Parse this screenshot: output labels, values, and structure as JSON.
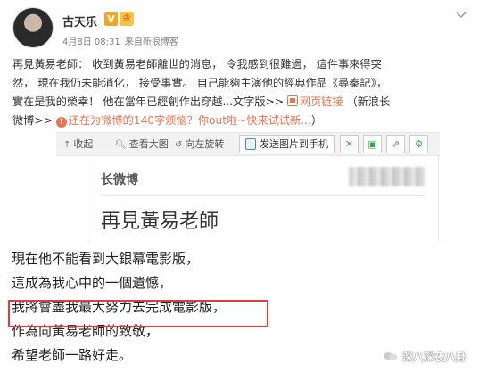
{
  "post": {
    "username": "古天乐",
    "verified_badge": "V",
    "vip_badge": "♔",
    "date": "4月8日 08:31",
    "from_label": "来自",
    "source": "新浪博客",
    "text_line1": "再見黃易老師： 收到黃易老師離世的消息， 令我感到很難過， 這件事來得突",
    "text_line2": "然， 現在我仍未能消化， 接受事實。 自己能夠主演他的經典作品《尋秦記》，",
    "text_line3a": "實在是我的榮幸！ 他在當年已經創作出穿越...文字版>>",
    "web_link": "网页链接",
    "text_line3b": "（新浪长",
    "text_line4a": "微博>>",
    "promo": "还在为微博的140字烦恼？你out啦~快来试试新...",
    "promo_suffix": "）"
  },
  "toolbar": {
    "collapse": "收起",
    "view_large": "查看大图",
    "rotate_left": "向左旋转",
    "send_to_phone": "发送图片到手机"
  },
  "article": {
    "brand": "长微博",
    "title": "再見黃易老師",
    "lines": [
      "現在他不能看到大銀幕電影版，",
      "這成為我心中的一個遺憾，",
      "我將會盡我最大努力去完成電影版，",
      "作為向黃易老師的致敬，",
      "希望老師一路好走。"
    ]
  },
  "watermark": "深八深夜八卦",
  "colors": {
    "accent_orange": "#eb7350",
    "highlight_red": "#e23b3b",
    "toolbar_bg": "#f2f2f2"
  }
}
